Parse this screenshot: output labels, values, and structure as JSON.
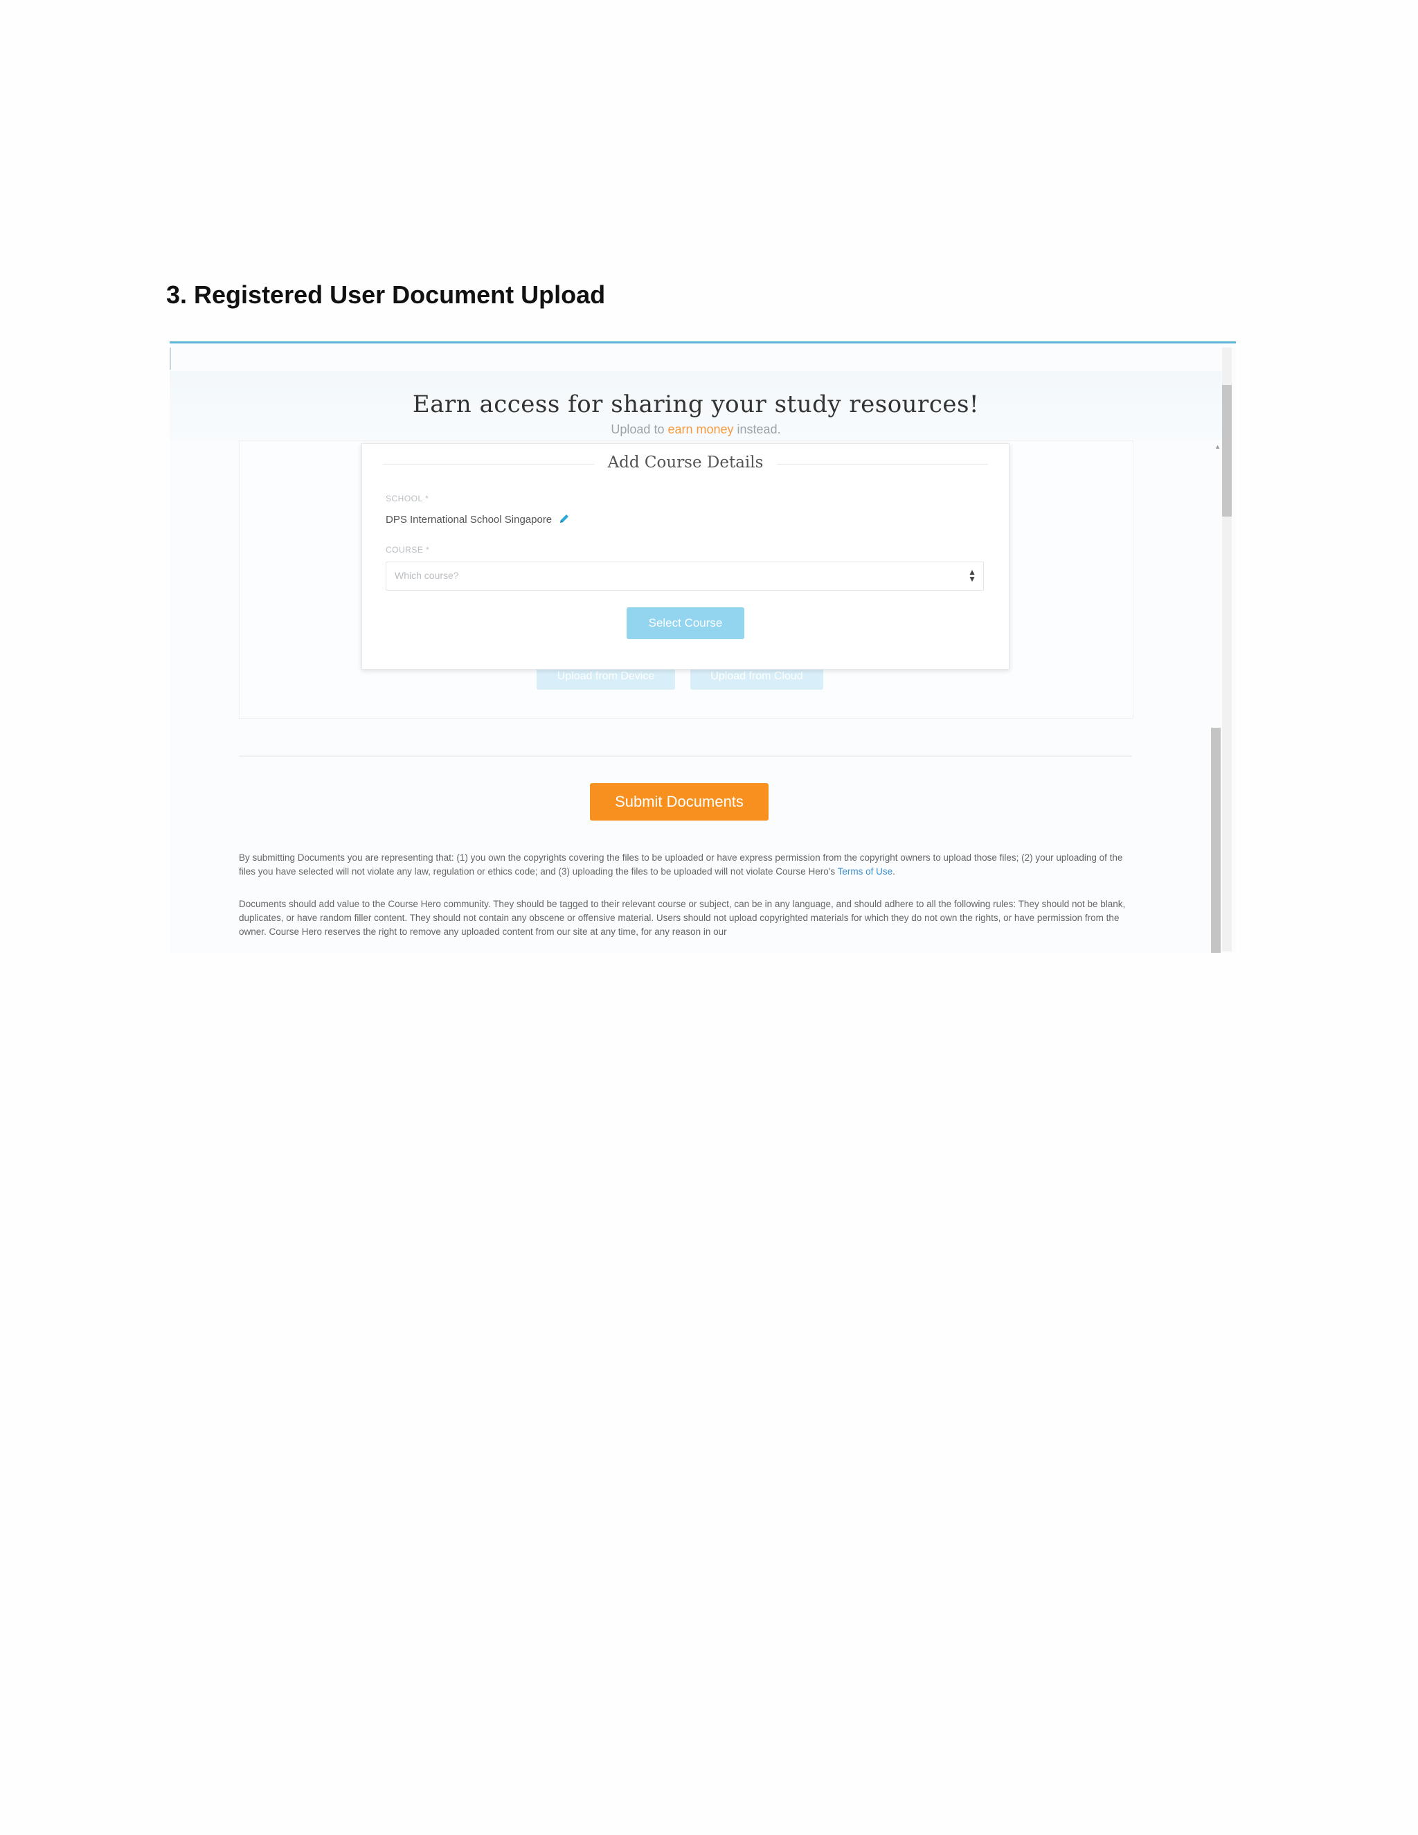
{
  "document": {
    "heading_number": "3.",
    "heading_text": "Registered User Document Upload"
  },
  "screenshot": {
    "banner": {
      "title": "Earn access for sharing your study resources!",
      "subtitle_before": "Upload to ",
      "subtitle_link": "earn money",
      "subtitle_after": " instead."
    },
    "modal": {
      "title": "Add Course Details",
      "school_label": "SCHOOL *",
      "school_value": "DPS International School Singapore",
      "course_label": "COURSE *",
      "course_placeholder": "Which course?",
      "select_button": "Select Course"
    },
    "upload_buttons": {
      "device": "Upload from Device",
      "cloud": "Upload from Cloud"
    },
    "submit_button": "Submit Documents",
    "legal": {
      "p1": "By submitting Documents you are representing that: (1) you own the copyrights covering the files to be uploaded or have express permission from the copyright owners to upload those files; (2) your uploading of the files you have selected will not violate any law, regulation or ethics code; and (3) uploading the files to be uploaded will not violate Course Hero's ",
      "p1_link": "Terms of Use",
      "p1_end": ".",
      "p2": "Documents should add value to the Course Hero community. They should be tagged to their relevant course or subject, can be in any language, and should adhere to all the following rules: They should not be blank, duplicates, or have random filler content. They should not contain any obscene or offensive material. Users should not upload copyrighted materials for which they do not own the rights, or have permission from the owner. Course Hero reserves the right to remove any uploaded content from our site at any time, for any reason in our"
    }
  },
  "colors": {
    "accent_orange": "#f7901e",
    "accent_blue": "#93d4ef",
    "link_blue": "#3a8fcf",
    "top_border": "#5cb6d8"
  },
  "icons": {
    "edit": "pencil-icon",
    "select_arrows": "select-arrows-icon"
  }
}
